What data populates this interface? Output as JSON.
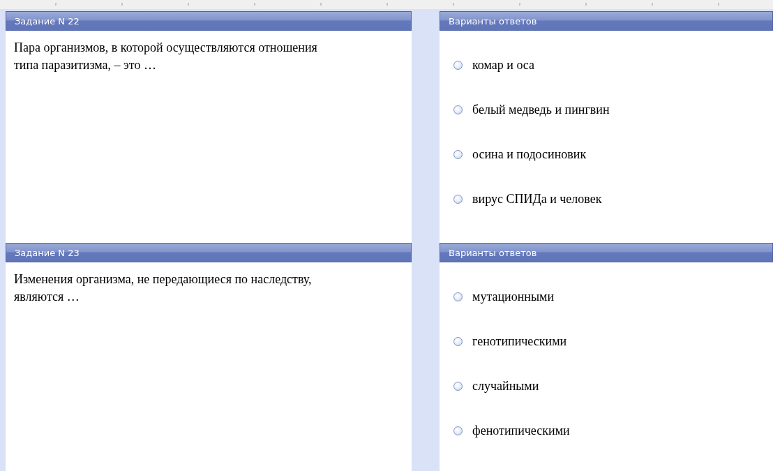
{
  "tasks": [
    {
      "title": "Задание N 22",
      "question": "Пара организмов, в которой осуществляются отношения типа паразитизма, – это …",
      "answers_title": "Варианты ответов",
      "options": [
        {
          "label": "комар и оса",
          "selected": false
        },
        {
          "label": "белый медведь и пингвин",
          "selected": false
        },
        {
          "label": "осина и подосиновик",
          "selected": false
        },
        {
          "label": "вирус СПИДа и человек",
          "selected": false
        }
      ]
    },
    {
      "title": "Задание N 23",
      "question": "Изменения организма, не передающиеся по наследству, являются …",
      "answers_title": "Варианты ответов",
      "options": [
        {
          "label": "мутационными",
          "selected": false
        },
        {
          "label": "генотипическими",
          "selected": false
        },
        {
          "label": "случайными",
          "selected": false
        },
        {
          "label": "фенотипическими",
          "selected": false
        }
      ]
    }
  ]
}
